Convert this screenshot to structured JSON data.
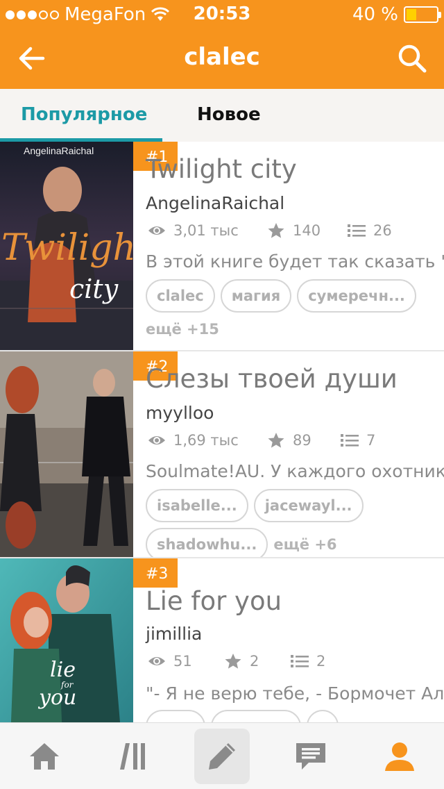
{
  "status_bar": {
    "carrier": "MegaFon",
    "signal_bars": 3,
    "time": "20:53",
    "battery_label": "40 %",
    "battery_level": 0.4
  },
  "nav": {
    "title": "clalec",
    "back_icon": "arrow-left-icon",
    "search_icon": "search-icon"
  },
  "tabs": [
    {
      "label": "Популярное",
      "active": true
    },
    {
      "label": "Новое",
      "active": false
    }
  ],
  "stories": [
    {
      "rank": "#1",
      "title": "Twilight city",
      "author": "AngelinaRaichal",
      "views": "3,01 тыс",
      "votes": "140",
      "parts": "26",
      "description": "В этой книге будет так сказать \"И",
      "tags": [
        "clalec",
        "магия",
        "сумеречн..."
      ],
      "more_tags": "ещё +15",
      "cover": {
        "top_text": "AngelinaRaichal",
        "title_a": "Twilight",
        "title_b": "city"
      }
    },
    {
      "rank": "#2",
      "title": "Слезы твоей души",
      "author": "myylloo",
      "views": "1,69 тыс",
      "votes": "89",
      "parts": "7",
      "description": "Soulmate!AU. У каждого охотника",
      "tags": [
        "isabelle...",
        "jacewayl...",
        "shadowhu..."
      ],
      "more_tags": "ещё +6"
    },
    {
      "rank": "#3",
      "title": "Lie for you",
      "author": "jimillia",
      "views": "51",
      "votes": "2",
      "parts": "2",
      "description": "\"- Я не верю тебе, - Бормочет Але",
      "tags": [],
      "more_tags": "",
      "cover": {
        "title_a": "lie",
        "title_b": "for",
        "title_c": "you"
      }
    }
  ],
  "bottom_nav": [
    {
      "icon": "home-icon",
      "active": false
    },
    {
      "icon": "library-icon",
      "active": false
    },
    {
      "icon": "pencil-icon",
      "active": true
    },
    {
      "icon": "messages-icon",
      "active": false
    },
    {
      "icon": "profile-icon",
      "active": false
    }
  ],
  "colors": {
    "brand_orange": "#f7941d",
    "tab_active": "#1c9aa6",
    "profile_active": "#f7941d",
    "icon_gray": "#8a8a8a"
  }
}
